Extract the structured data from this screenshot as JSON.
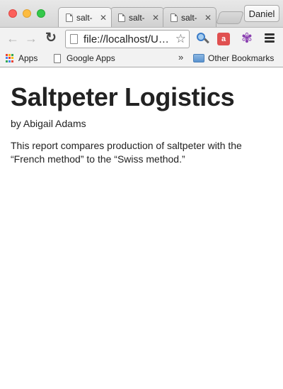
{
  "window": {
    "tabs": [
      {
        "title": "salt-",
        "close": "✕",
        "active": true
      },
      {
        "title": "salt-",
        "close": "✕",
        "active": false
      },
      {
        "title": "salt-",
        "close": "✕",
        "active": false
      }
    ],
    "profile_name": "Daniel"
  },
  "toolbar": {
    "back_icon": "back-arrow-icon",
    "forward_icon": "forward-arrow-icon",
    "reload_icon": "reload-icon",
    "url": "file://localhost/U…",
    "star_glyph": "☆",
    "bubble_glyph": "a",
    "menu_icon": "hamburger-menu-icon"
  },
  "bookmarks": {
    "apps_label": "Apps",
    "google_apps_label": "Google Apps",
    "overflow_glyph": "»",
    "other_label": "Other Bookmarks",
    "apps_colors": [
      "#e94235",
      "#fbbc05",
      "#34a853",
      "#4285f4",
      "#e94235",
      "#fbbc05",
      "#34a853",
      "#4285f4",
      "#e94235"
    ]
  },
  "document": {
    "title": "Saltpeter Logistics",
    "byline": "by Abigail Adams",
    "body": "This report compares production of saltpeter with the “French method” to the “Swiss method.”"
  }
}
